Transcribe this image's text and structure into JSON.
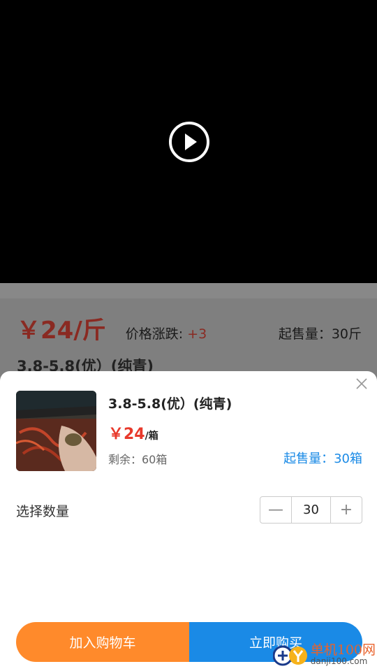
{
  "status_bar": {
    "icons": [
      "download-icon",
      "app-icon",
      "robot-icon"
    ]
  },
  "video": {
    "play_icon": "play-icon"
  },
  "background_page": {
    "price": "￥24/斤",
    "change_label": "价格涨跌:",
    "change_value": "+3",
    "min_sale": "起售量：30斤",
    "title": "3.8-5.8(优）(纯青)"
  },
  "sheet": {
    "title": "3.8-5.8(优）(纯青)",
    "price": "￥24",
    "unit": "/箱",
    "stock": "剩余：60箱",
    "min_sale": "起售量：30箱",
    "quantity_label": "选择数量",
    "quantity_value": "30",
    "minus": "—",
    "plus": "+",
    "add_to_cart": "加入购物车",
    "buy_now": "立即购买"
  },
  "watermark": {
    "cn": "单机100网",
    "en": "danji100.com"
  },
  "colors": {
    "orange": "#ff8a2b",
    "blue": "#1a8ae6",
    "red": "#e8392b"
  }
}
